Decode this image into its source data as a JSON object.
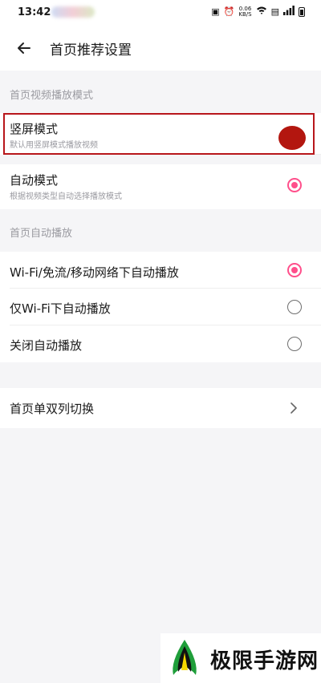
{
  "status_bar": {
    "time": "13:42",
    "net_speed": "0.06",
    "net_unit": "KB/S"
  },
  "header": {
    "title": "首页推荐设置",
    "back_icon": "arrow-left-icon"
  },
  "sections": {
    "video_mode": {
      "label": "首页视频播放模式",
      "options": [
        {
          "label": "竖屏模式",
          "subtitle": "默认用竖屏模式播放视频",
          "selected": true
        },
        {
          "label": "自动模式",
          "subtitle": "根据视频类型自动选择播放模式",
          "selected": true
        }
      ]
    },
    "autoplay": {
      "label": "首页自动播放",
      "options": [
        {
          "label": "Wi-Fi/免流/移动网络下自动播放",
          "selected": true
        },
        {
          "label": "仅Wi-Fi下自动播放",
          "selected": false
        },
        {
          "label": "关闭自动播放",
          "selected": false
        }
      ]
    },
    "layout": {
      "label": "首页单双列切换"
    }
  },
  "watermark": {
    "text": "极限手游网"
  },
  "colors": {
    "accent": "#ff4f8b",
    "highlight": "#b8161b"
  }
}
